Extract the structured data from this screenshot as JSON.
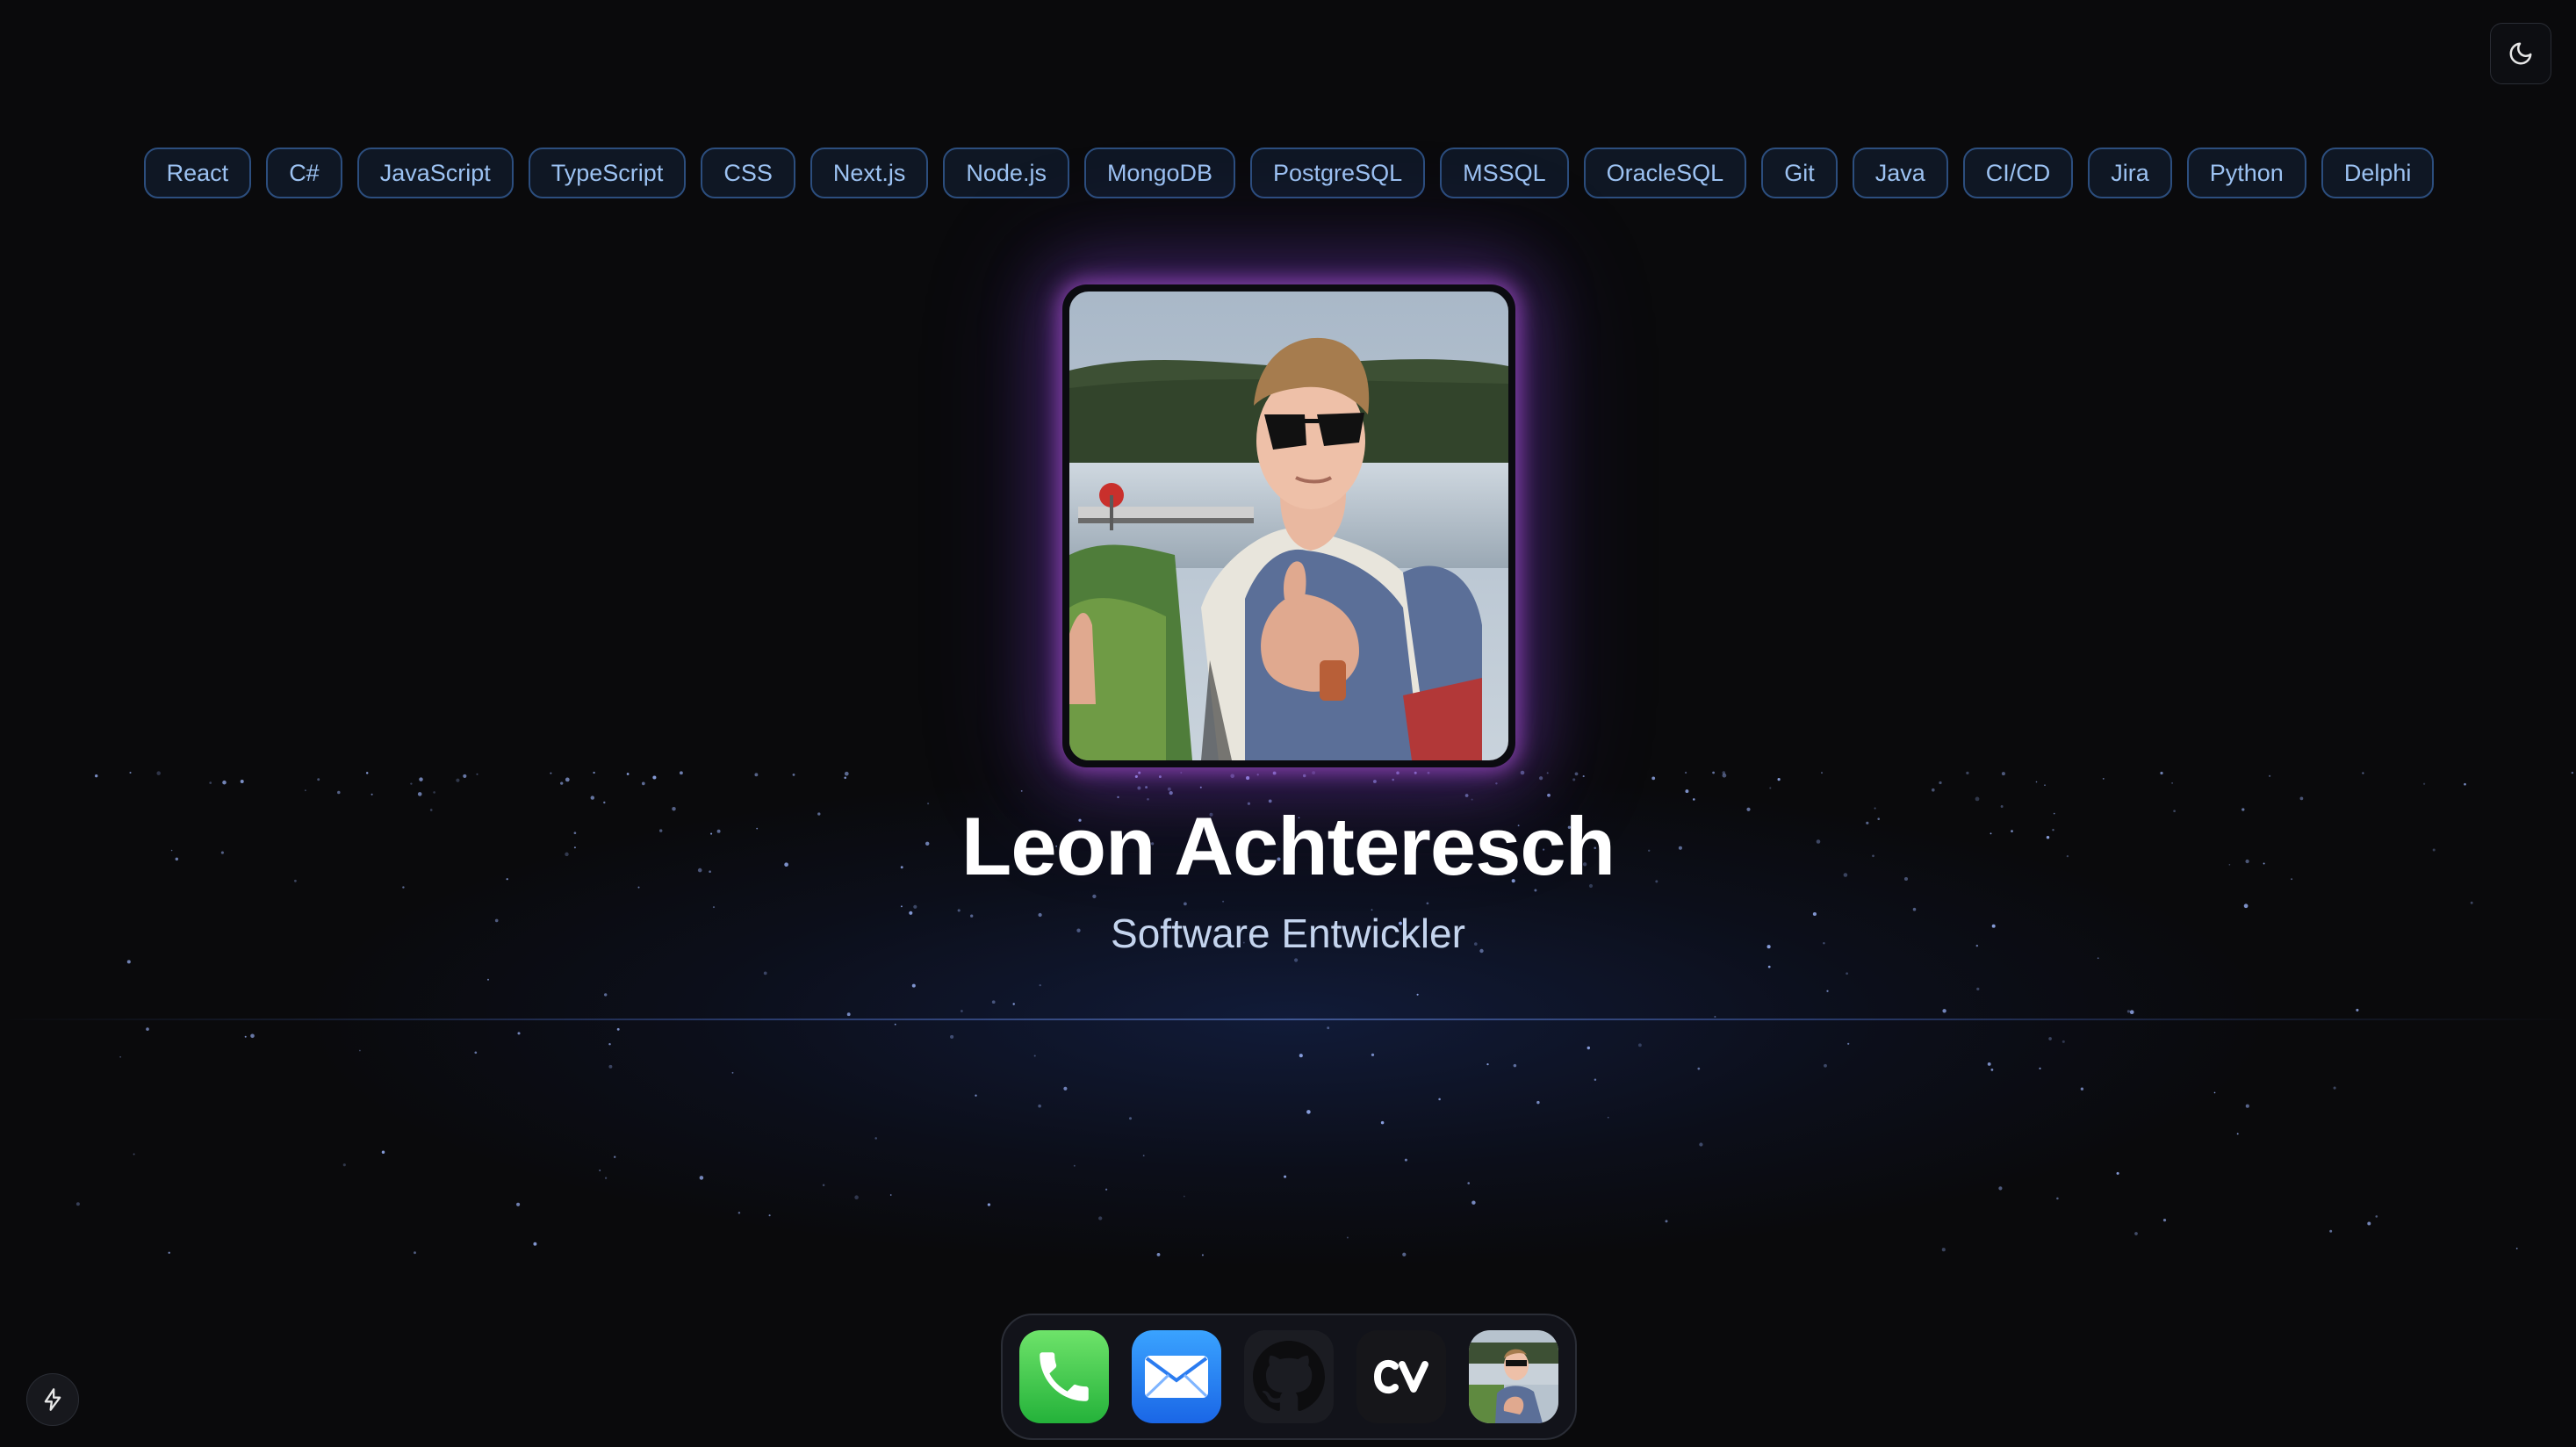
{
  "header": {
    "theme_toggle_icon": "moon-icon"
  },
  "skills": [
    "React",
    "C#",
    "JavaScript",
    "TypeScript",
    "CSS",
    "Next.js",
    "Node.js",
    "MongoDB",
    "PostgreSQL",
    "MSSQL",
    "OracleSQL",
    "Git",
    "Java",
    "CI/CD",
    "Jira",
    "Python",
    "Delphi"
  ],
  "profile": {
    "name": "Leon Achteresch",
    "title": "Software Entwickler"
  },
  "dock": {
    "apps": [
      {
        "id": "phone",
        "icon": "phone-icon"
      },
      {
        "id": "mail",
        "icon": "mail-icon"
      },
      {
        "id": "github",
        "icon": "github-icon"
      },
      {
        "id": "cv",
        "icon": "cv-icon",
        "label": "CV"
      },
      {
        "id": "photo",
        "icon": "profile-photo-icon"
      }
    ]
  },
  "footer": {
    "bolt_icon": "bolt-icon"
  },
  "colors": {
    "background": "#0a0a0c",
    "skill_border": "#2c4e7e",
    "skill_text": "#9cc2f2",
    "avatar_glow": "#be5ae6",
    "horizon_glow": "#3b82f6"
  }
}
